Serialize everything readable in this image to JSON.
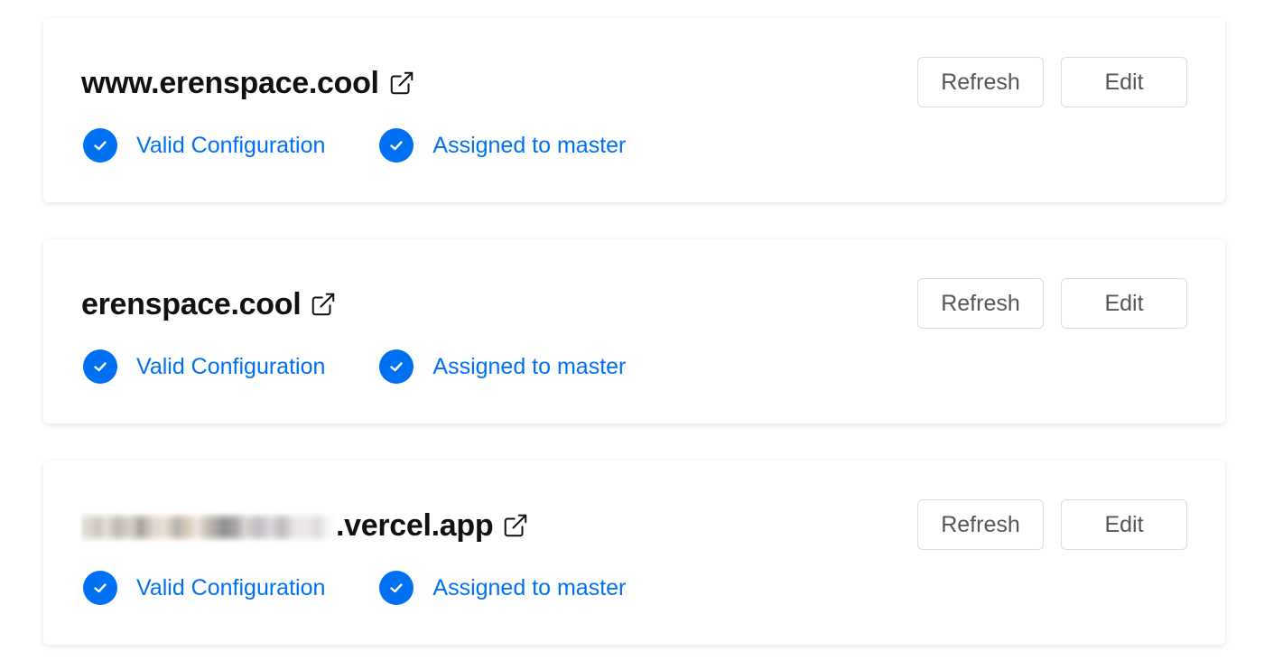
{
  "domains": [
    {
      "name": "www.erenspace.cool",
      "blurred_prefix": false,
      "statuses": [
        "Valid Configuration",
        "Assigned to master"
      ],
      "refresh_label": "Refresh",
      "edit_label": "Edit"
    },
    {
      "name": "erenspace.cool",
      "blurred_prefix": false,
      "statuses": [
        "Valid Configuration",
        "Assigned to master"
      ],
      "refresh_label": "Refresh",
      "edit_label": "Edit"
    },
    {
      "name": ".vercel.app",
      "blurred_prefix": true,
      "statuses": [
        "Valid Configuration",
        "Assigned to master"
      ],
      "refresh_label": "Refresh",
      "edit_label": "Edit"
    }
  ],
  "icons": {
    "external": "external-link-icon",
    "status": "check-circle-icon"
  },
  "colors": {
    "accent": "#0070f3",
    "title": "#111111",
    "button_text": "#555555",
    "button_border": "#dcdcdc"
  }
}
